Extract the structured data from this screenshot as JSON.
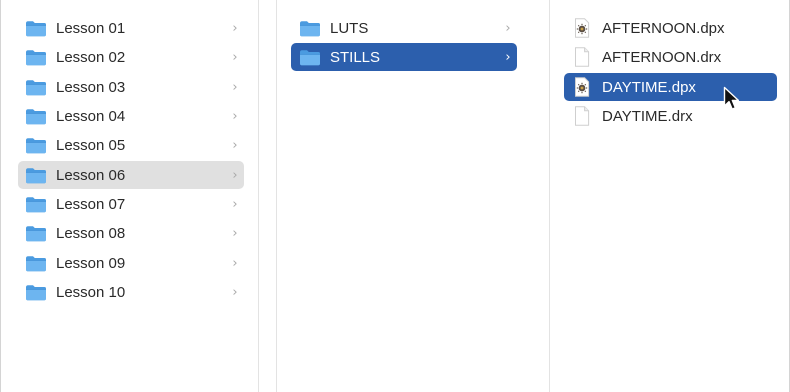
{
  "colors": {
    "selection_active": "#2c5fad",
    "selection_inactive": "#e0e0e0",
    "folder_blue": "#5aa8e8"
  },
  "column1": {
    "items": [
      {
        "label": "Lesson 01",
        "icon": "folder-icon"
      },
      {
        "label": "Lesson 02",
        "icon": "folder-icon"
      },
      {
        "label": "Lesson 03",
        "icon": "folder-icon"
      },
      {
        "label": "Lesson 04",
        "icon": "folder-icon"
      },
      {
        "label": "Lesson 05",
        "icon": "folder-icon"
      },
      {
        "label": "Lesson 06",
        "icon": "folder-icon",
        "state": "selected-inactive"
      },
      {
        "label": "Lesson 07",
        "icon": "folder-icon"
      },
      {
        "label": "Lesson 08",
        "icon": "folder-icon"
      },
      {
        "label": "Lesson 09",
        "icon": "folder-icon"
      },
      {
        "label": "Lesson 10",
        "icon": "folder-icon"
      }
    ],
    "chevron": "›"
  },
  "column2": {
    "items": [
      {
        "label": "LUTS",
        "icon": "folder-icon"
      },
      {
        "label": "STILLS",
        "icon": "folder-icon",
        "state": "selected-active"
      }
    ],
    "chevron": "›"
  },
  "column3": {
    "items": [
      {
        "label": "AFTERNOON.dpx",
        "icon": "dpx-image-icon"
      },
      {
        "label": "AFTERNOON.drx",
        "icon": "blank-document-icon"
      },
      {
        "label": "DAYTIME.dpx",
        "icon": "dpx-image-icon",
        "state": "selected-active"
      },
      {
        "label": "DAYTIME.drx",
        "icon": "blank-document-icon"
      }
    ]
  },
  "cursor": {
    "icon": "arrow-cursor-icon"
  }
}
